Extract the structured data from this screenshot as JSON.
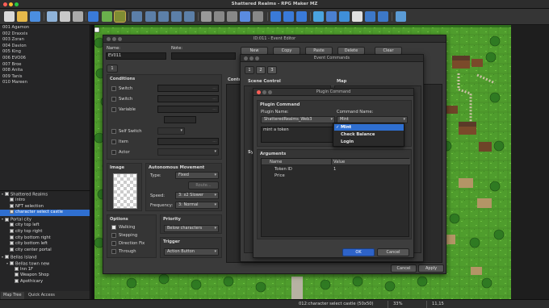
{
  "app": {
    "title": "Shattered Realms - RPG Maker MZ"
  },
  "map_list": [
    "001 Agamon",
    "002 Draxxis",
    "003 Zoran",
    "004 Davion",
    "005 King",
    "006 EVO06",
    "007 Broe",
    "008 Anita",
    "009 Tanis",
    "010 Mareen"
  ],
  "map_tree": [
    {
      "label": "Shattered Realms",
      "level": 0,
      "expand": "▾"
    },
    {
      "label": "intro",
      "level": 1
    },
    {
      "label": "NFT selection",
      "level": 1
    },
    {
      "label": "character select castle",
      "level": 1,
      "selected": true
    },
    {
      "label": "Portal city",
      "level": 0,
      "expand": "▾"
    },
    {
      "label": "city top left",
      "level": 1
    },
    {
      "label": "city top right",
      "level": 1
    },
    {
      "label": "city bottom right",
      "level": 1
    },
    {
      "label": "city bottom left",
      "level": 1
    },
    {
      "label": "city center portal",
      "level": 1
    },
    {
      "label": "Bellas Island",
      "level": 0,
      "expand": "▾"
    },
    {
      "label": "Bellas town new",
      "level": 1,
      "expand": "▾"
    },
    {
      "label": "Inn 1F",
      "level": 2
    },
    {
      "label": "Weapon Shop",
      "level": 2
    },
    {
      "label": "Apothicary",
      "level": 2
    }
  ],
  "tabs": {
    "map_tree": "Map Tree",
    "quick_access": "Quick Access"
  },
  "status": {
    "map": "012:character select castle (50x50)",
    "zoom": "33%",
    "coords": "11,15"
  },
  "event_editor": {
    "title": "ID:011 - Event Editor",
    "name_label": "Name:",
    "name_value": "EV011",
    "note_label": "Note:",
    "page_tab": "1",
    "conditions_label": "Conditions",
    "cond_switch1": "Switch",
    "cond_switch2": "Switch",
    "cond_variable": "Variable",
    "cond_self_switch": "Self Switch",
    "cond_item": "Item",
    "cond_actor": "Actor",
    "dots": "...",
    "contents_label": "Conte",
    "image_label": "Image",
    "auto_move_label": "Autonomous Movement",
    "type_label": "Type:",
    "type_value": "Fixed",
    "route_btn": "Route...",
    "speed_label": "Speed:",
    "speed_value": "3: x2 Slower",
    "freq_label": "Frequency:",
    "freq_value": "3: Normal",
    "options_label": "Options",
    "opt_walking": "Walking",
    "opt_stepping": "Stepping",
    "opt_direction_fix": "Direction Fix",
    "opt_through": "Through",
    "priority_label": "Priority",
    "priority_value": "Below characters",
    "trigger_label": "Trigger",
    "trigger_value": "Action Button",
    "cancel": "Cancel",
    "apply": "Apply"
  },
  "page_toolbar": {
    "new": "New",
    "copy": "Copy",
    "paste": "Paste",
    "delete": "Delete",
    "clear": "Clear"
  },
  "event_commands": {
    "title": "Event Commands",
    "tabs": [
      "1",
      "2",
      "3"
    ],
    "scene_control": "Scene Control",
    "map": "Map",
    "sy": "Sy"
  },
  "plugin_command": {
    "title": "Plugin Command",
    "group_label": "Plugin Command",
    "plugin_name_label": "Plugin Name:",
    "plugin_name_value": "ShatteredRealms_Web3",
    "command_name_label": "Command Name:",
    "command_name_value": "Mint",
    "description": "mint a token",
    "dropdown_options": [
      "Mint",
      "Check Balance",
      "Login"
    ],
    "arguments_label": "Arguments",
    "columns": [
      "Name",
      "Value"
    ],
    "rows": [
      {
        "name": "Token ID",
        "value": "1"
      },
      {
        "name": "Price",
        "value": ""
      }
    ],
    "ok": "OK",
    "cancel": "Cancel"
  }
}
